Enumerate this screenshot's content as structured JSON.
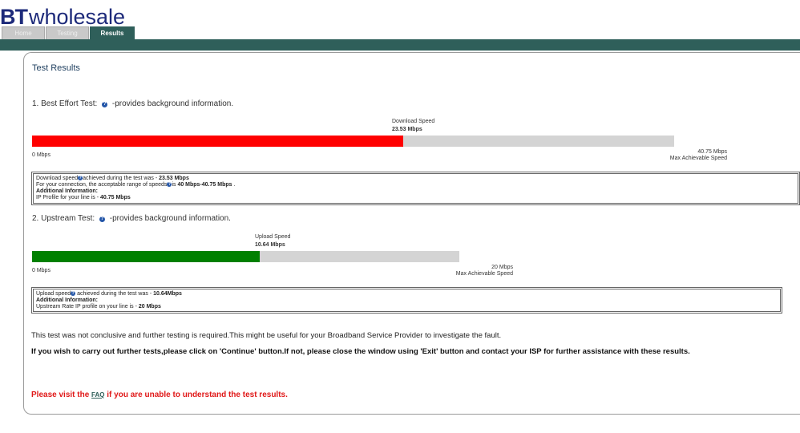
{
  "header": {
    "logo_bt": "BT",
    "logo_wholesale": "wholesale",
    "tabs": [
      {
        "label": "Home",
        "active": false
      },
      {
        "label": "Testing",
        "active": false
      },
      {
        "label": "Results",
        "active": true
      }
    ]
  },
  "page": {
    "title": "Test Results"
  },
  "download_test": {
    "heading_prefix": "1. Best Effort Test: ",
    "heading_suffix": " -provides background information.",
    "speed_caption": "Download Speed",
    "speed_value": "23.53 Mbps",
    "min_label": "0 Mbps",
    "max_value": "40.75 Mbps",
    "max_caption": "Max Achievable Speed",
    "measured_mbps": 23.53,
    "max_mbps": 40.75,
    "fill_color": "#ff0000",
    "track_color": "#d4d4d4",
    "info": {
      "line1_prefix": "Download speed",
      "line1_mid": "achieved during the test was - ",
      "line1_value": "23.53 Mbps",
      "line2_prefix": "For your connection, the acceptable range of speeds",
      "line2_mid": "is ",
      "line2_value": "40 Mbps-40.75 Mbps",
      "line2_suffix": " .",
      "line3": "Additional Information:",
      "line4_prefix": "IP Profile for your line is - ",
      "line4_value": "40.75 Mbps"
    }
  },
  "upload_test": {
    "heading_prefix": "2. Upstream Test: ",
    "heading_suffix": " -provides background information.",
    "speed_caption": "Upload Speed",
    "speed_value": "10.64 Mbps",
    "min_label": "0 Mbps",
    "max_value": "20 Mbps",
    "max_caption": "Max Achievable Speed",
    "measured_mbps": 10.64,
    "max_mbps": 20,
    "fill_color": "#008000",
    "track_color": "#d4d4d4",
    "info": {
      "line1_prefix": "Upload speed",
      "line1_mid": " achieved during the test was - ",
      "line1_value": "10.64Mbps",
      "line2": "Additional Information:",
      "line3_prefix": "Upstream Rate IP profile on your line is - ",
      "line3_value": "20 Mbps"
    }
  },
  "notes": {
    "inconclusive": "This test was not conclusive and further testing is required.This might be useful for your Broadband Service Provider to investigate the fault.",
    "further_tests": "If you wish to carry out further tests,please click on 'Continue' button.If not, please close the window using 'Exit' button and contact your ISP for further assistance with these results.",
    "faq_prefix": "Please visit the ",
    "faq_link": "FAQ",
    "faq_suffix": " if you are unable to understand the test results."
  },
  "icons": {
    "help": "help-icon"
  }
}
